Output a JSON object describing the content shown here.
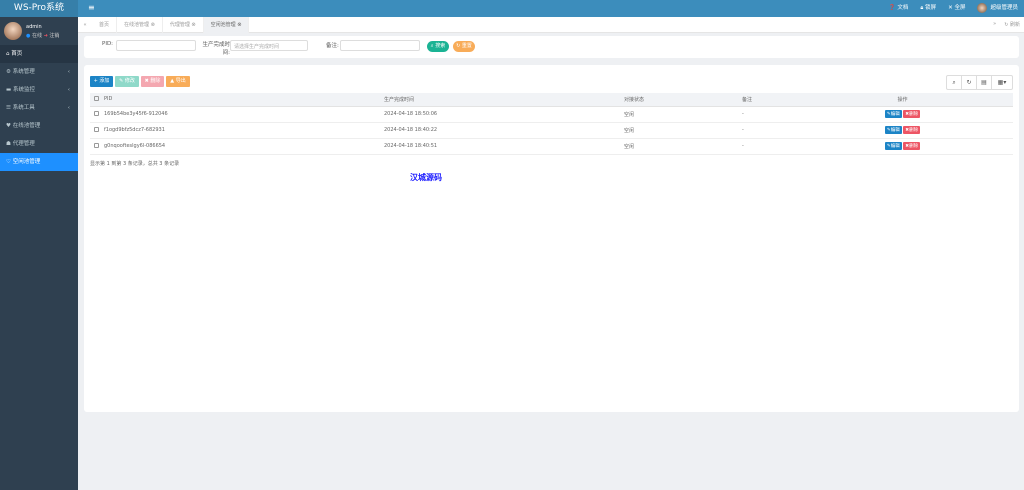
{
  "app": {
    "title": "WS-Pro系统"
  },
  "user": {
    "name": "admin",
    "online": "在线",
    "logout": "注销"
  },
  "sidebar": {
    "items": [
      {
        "label": "首页"
      },
      {
        "label": "系统管理"
      },
      {
        "label": "系统监控"
      },
      {
        "label": "系统工具"
      },
      {
        "label": "在线池管理"
      },
      {
        "label": "代理管理"
      },
      {
        "label": "空闲池管理"
      }
    ]
  },
  "topbar": {
    "menu_icon": "bars-icon",
    "docs": "文档",
    "lock": "锁屏",
    "fullscreen": "全屏",
    "account": "超级管理员"
  },
  "tabs": {
    "items": [
      {
        "label": "首页"
      },
      {
        "label": "在线池管理"
      },
      {
        "label": "代理管理"
      },
      {
        "label": "空闲池管理"
      }
    ],
    "refresh": "刷新"
  },
  "search": {
    "pid_label": "PID:",
    "time_label": "生产完成时间:",
    "time_placeholder": "请选择生产完成时间",
    "note_label": "备注:",
    "search_btn": "搜索",
    "reset_btn": "重置"
  },
  "toolbar": {
    "add": "添加",
    "edit": "修改",
    "delete": "删除",
    "export": "导出"
  },
  "table": {
    "headers": [
      "PID",
      "生产完成时间",
      "对接状态",
      "备注",
      "操作"
    ],
    "rows": [
      {
        "pid": "169b54be3y45f6-912046",
        "time": "2024-04-18 18:50:06",
        "status": "空闲",
        "note": "-"
      },
      {
        "pid": "f1ogd9bfz5dcz7-682931",
        "time": "2024-04-18 18:40:22",
        "status": "空闲",
        "note": "-"
      },
      {
        "pid": "g0nqoofteslgy6l-086654",
        "time": "2024-04-18 18:40:51",
        "status": "空闲",
        "note": "-"
      }
    ],
    "edit": "编辑",
    "remove": "删除"
  },
  "pager": "显示第 1 到第 3 条记录，总共 3 条记录",
  "watermark": "汉城源码",
  "colors": {
    "sidebar": "#2f4050",
    "topbar": "#3c8dbc",
    "active": "#1e90ff",
    "primary": "#1c84c6",
    "success": "#1ab394",
    "danger": "#ed5565",
    "warning": "#f8ac59"
  }
}
